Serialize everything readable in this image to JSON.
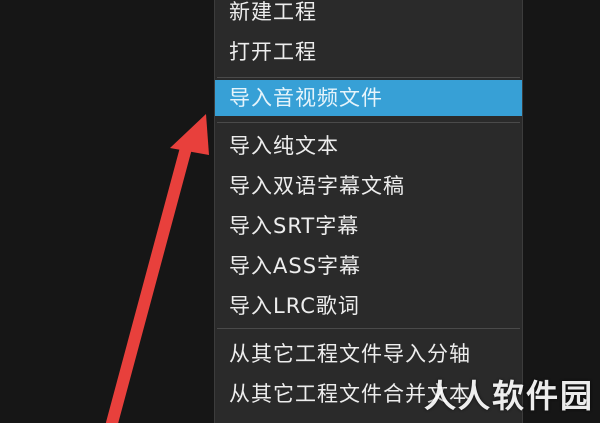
{
  "menu": {
    "items": [
      {
        "label": "新建工程"
      },
      {
        "label": "打开工程"
      },
      {
        "label": "导入音视频文件",
        "highlighted": true
      },
      {
        "label": "导入纯文本"
      },
      {
        "label": "导入双语字幕文稿"
      },
      {
        "label": "导入SRT字幕"
      },
      {
        "label": "导入ASS字幕"
      },
      {
        "label": "导入LRC歌词"
      },
      {
        "label": "从其它工程文件导入分轴"
      },
      {
        "label": "从其它工程文件合并文本"
      }
    ]
  },
  "annotation": {
    "arrow_color": "#e8403c"
  },
  "watermark": {
    "text": "人人软件园"
  },
  "colors": {
    "background": "#161616",
    "menu_background": "#2a2a2a",
    "highlight": "#37a0d6",
    "text": "#ededed"
  }
}
